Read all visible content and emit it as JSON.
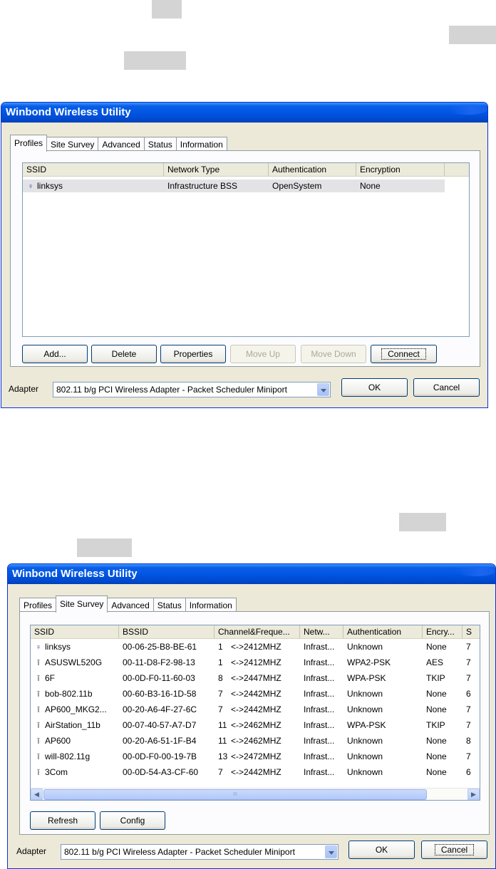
{
  "window1": {
    "title": "Winbond Wireless Utility",
    "tabs": [
      "Profiles",
      "Site Survey",
      "Advanced",
      "Status",
      "Information"
    ],
    "active_tab": "Profiles",
    "columns": [
      "SSID",
      "Network Type",
      "Authentication",
      "Encryption"
    ],
    "rows": [
      {
        "ssid": "linksys",
        "network_type": "Infrastructure BSS",
        "authentication": "OpenSystem",
        "encryption": "None",
        "icon": "connected-antenna-icon"
      }
    ],
    "buttons": {
      "add": "Add...",
      "delete": "Delete",
      "properties": "Properties",
      "move_up": "Move Up",
      "move_down": "Move Down",
      "connect": "Connect"
    },
    "adapter_label": "Adapter",
    "adapter_value": "802.11 b/g PCI Wireless Adapter - Packet Scheduler Miniport",
    "ok": "OK",
    "cancel": "Cancel"
  },
  "window2": {
    "title": "Winbond Wireless Utility",
    "tabs": [
      "Profiles",
      "Site Survey",
      "Advanced",
      "Status",
      "Information"
    ],
    "active_tab": "Site Survey",
    "columns": [
      "SSID",
      "BSSID",
      "Channel&Freque...",
      "Netw...",
      "Authentication",
      "Encry...",
      "S"
    ],
    "rows": [
      {
        "ssid": "linksys",
        "bssid": "00-06-25-B8-BE-61",
        "channel": "1",
        "freq": "<->2412MHZ",
        "network": "Infrast...",
        "authentication": "Unknown",
        "encryption": "None",
        "signal": "7",
        "icon": "connected-antenna-icon"
      },
      {
        "ssid": "ASUSWL520G",
        "bssid": "00-11-D8-F2-98-13",
        "channel": "1",
        "freq": "<->2412MHZ",
        "network": "Infrast...",
        "authentication": "WPA2-PSK",
        "encryption": "AES",
        "signal": "7",
        "icon": "antenna-icon"
      },
      {
        "ssid": "6F",
        "bssid": "00-0D-F0-11-60-03",
        "channel": "8",
        "freq": "<->2447MHZ",
        "network": "Infrast...",
        "authentication": "WPA-PSK",
        "encryption": "TKIP",
        "signal": "7",
        "icon": "antenna-icon"
      },
      {
        "ssid": "bob-802.11b",
        "bssid": "00-60-B3-16-1D-58",
        "channel": "7",
        "freq": "<->2442MHZ",
        "network": "Infrast...",
        "authentication": "Unknown",
        "encryption": "None",
        "signal": "6",
        "icon": "antenna-icon"
      },
      {
        "ssid": "AP600_MKG2...",
        "bssid": "00-20-A6-4F-27-6C",
        "channel": "7",
        "freq": "<->2442MHZ",
        "network": "Infrast...",
        "authentication": "Unknown",
        "encryption": "None",
        "signal": "7",
        "icon": "antenna-icon"
      },
      {
        "ssid": "AirStation_11b",
        "bssid": "00-07-40-57-A7-D7",
        "channel": "11",
        "freq": "<->2462MHZ",
        "network": "Infrast...",
        "authentication": "WPA-PSK",
        "encryption": "TKIP",
        "signal": "7",
        "icon": "antenna-icon"
      },
      {
        "ssid": "AP600",
        "bssid": "00-20-A6-51-1F-B4",
        "channel": "11",
        "freq": "<->2462MHZ",
        "network": "Infrast...",
        "authentication": "Unknown",
        "encryption": "None",
        "signal": "8",
        "icon": "antenna-icon"
      },
      {
        "ssid": "will-802.11g",
        "bssid": "00-0D-F0-00-19-7B",
        "channel": "13",
        "freq": "<->2472MHZ",
        "network": "Infrast...",
        "authentication": "Unknown",
        "encryption": "None",
        "signal": "7",
        "icon": "antenna-icon"
      },
      {
        "ssid": "3Com",
        "bssid": "00-0D-54-A3-CF-60",
        "channel": "7",
        "freq": "<->2442MHZ",
        "network": "Infrast...",
        "authentication": "Unknown",
        "encryption": "None",
        "signal": "6",
        "icon": "antenna-icon"
      }
    ],
    "scrollbar_grip": "III",
    "buttons": {
      "refresh": "Refresh",
      "config": "Config"
    },
    "adapter_label": "Adapter",
    "adapter_value": "802.11 b/g PCI Wireless Adapter - Packet Scheduler Miniport",
    "ok": "OK",
    "cancel": "Cancel"
  },
  "colors": {
    "titlebar": "#0054e3",
    "dialog_bg": "#ece9d8",
    "highlight": "#d4d4d4"
  }
}
